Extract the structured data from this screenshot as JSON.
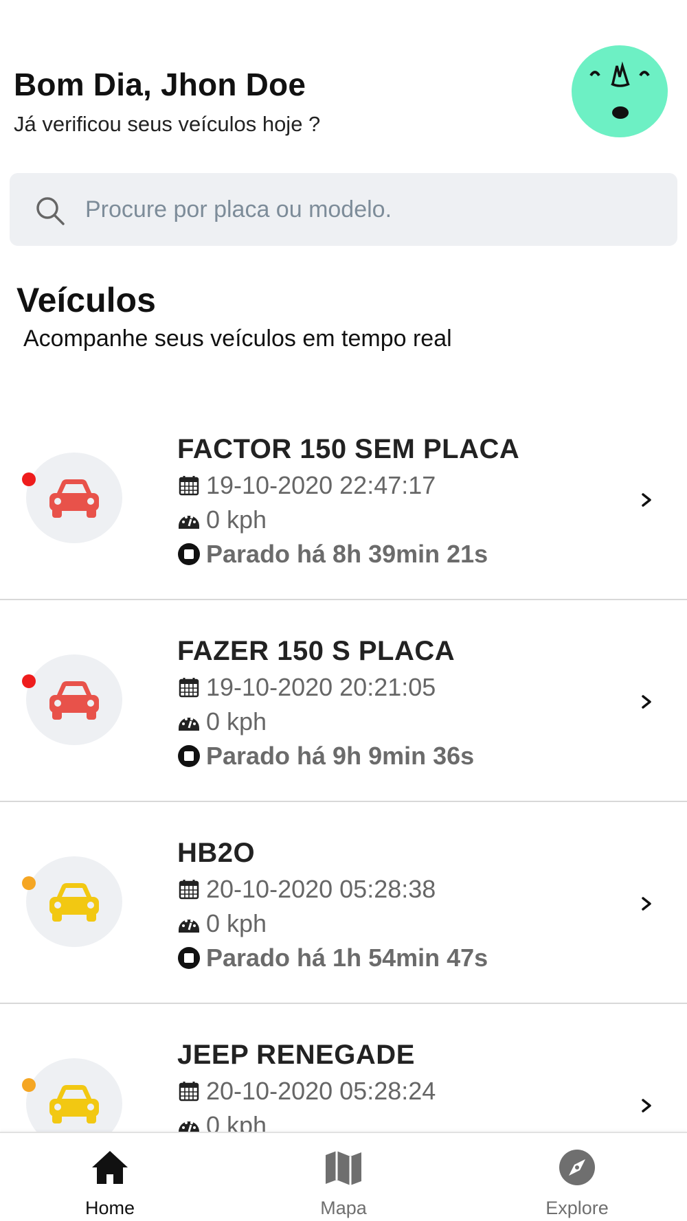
{
  "header": {
    "greeting": "Bom Dia, Jhon Doe",
    "subtitle": "Já verificou seus veículos hoje ?",
    "avatar_color": "#6df0c4"
  },
  "search": {
    "placeholder": "Procure por placa ou modelo.",
    "value": ""
  },
  "section": {
    "title": "Veículos",
    "subtitle": "Acompanhe seus veículos em tempo real"
  },
  "vehicles": [
    {
      "name": "FACTOR 150 SEM PLACA",
      "datetime": "19-10-2020 22:47:17",
      "speed": "0 kph",
      "status": "Parado há 8h 39min 21s",
      "icon_color": "#e8524a",
      "dot_color": "#ee1c1c"
    },
    {
      "name": "FAZER 150 S PLACA",
      "datetime": "19-10-2020 20:21:05",
      "speed": "0 kph",
      "status": "Parado há 9h 9min 36s",
      "icon_color": "#e8524a",
      "dot_color": "#ee1c1c"
    },
    {
      "name": "HB2O",
      "datetime": "20-10-2020 05:28:38",
      "speed": "0 kph",
      "status": "Parado há 1h 54min 47s",
      "icon_color": "#f2c812",
      "dot_color": "#f5a623"
    },
    {
      "name": "JEEP RENEGADE",
      "datetime": "20-10-2020 05:28:24",
      "speed": "0 kph",
      "status": "",
      "icon_color": "#f2c812",
      "dot_color": "#f5a623"
    }
  ],
  "icons": {
    "date": "calendar-icon",
    "speed": "speedometer-icon",
    "status": "stop-icon",
    "vehicle": "car-icon",
    "chevron": "chevron-right-icon"
  },
  "nav": {
    "items": [
      {
        "label": "Home",
        "icon": "home-icon",
        "active": true
      },
      {
        "label": "Mapa",
        "icon": "map-icon",
        "active": false
      },
      {
        "label": "Explore",
        "icon": "compass-icon",
        "active": false
      }
    ],
    "active_color": "#111111",
    "inactive_color": "#6f6f6f"
  }
}
